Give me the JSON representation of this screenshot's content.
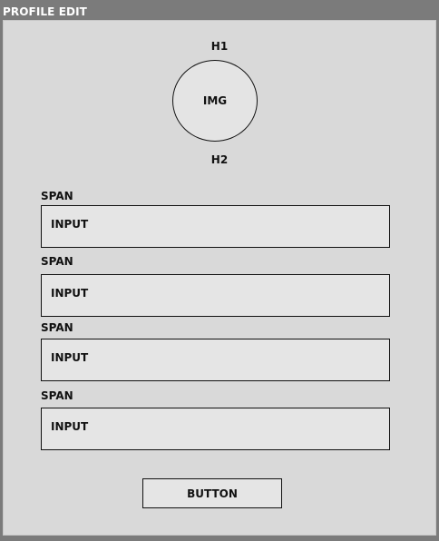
{
  "window": {
    "title": "PROFILE EDIT"
  },
  "header": {
    "h1": "H1",
    "img_label": "IMG",
    "h2": "H2"
  },
  "form": {
    "fields": [
      {
        "label": "SPAN",
        "input_text": "INPUT"
      },
      {
        "label": "SPAN",
        "input_text": "INPUT"
      },
      {
        "label": "SPAN",
        "input_text": "INPUT"
      },
      {
        "label": "SPAN",
        "input_text": "INPUT"
      }
    ],
    "button_label": "BUTTON"
  }
}
